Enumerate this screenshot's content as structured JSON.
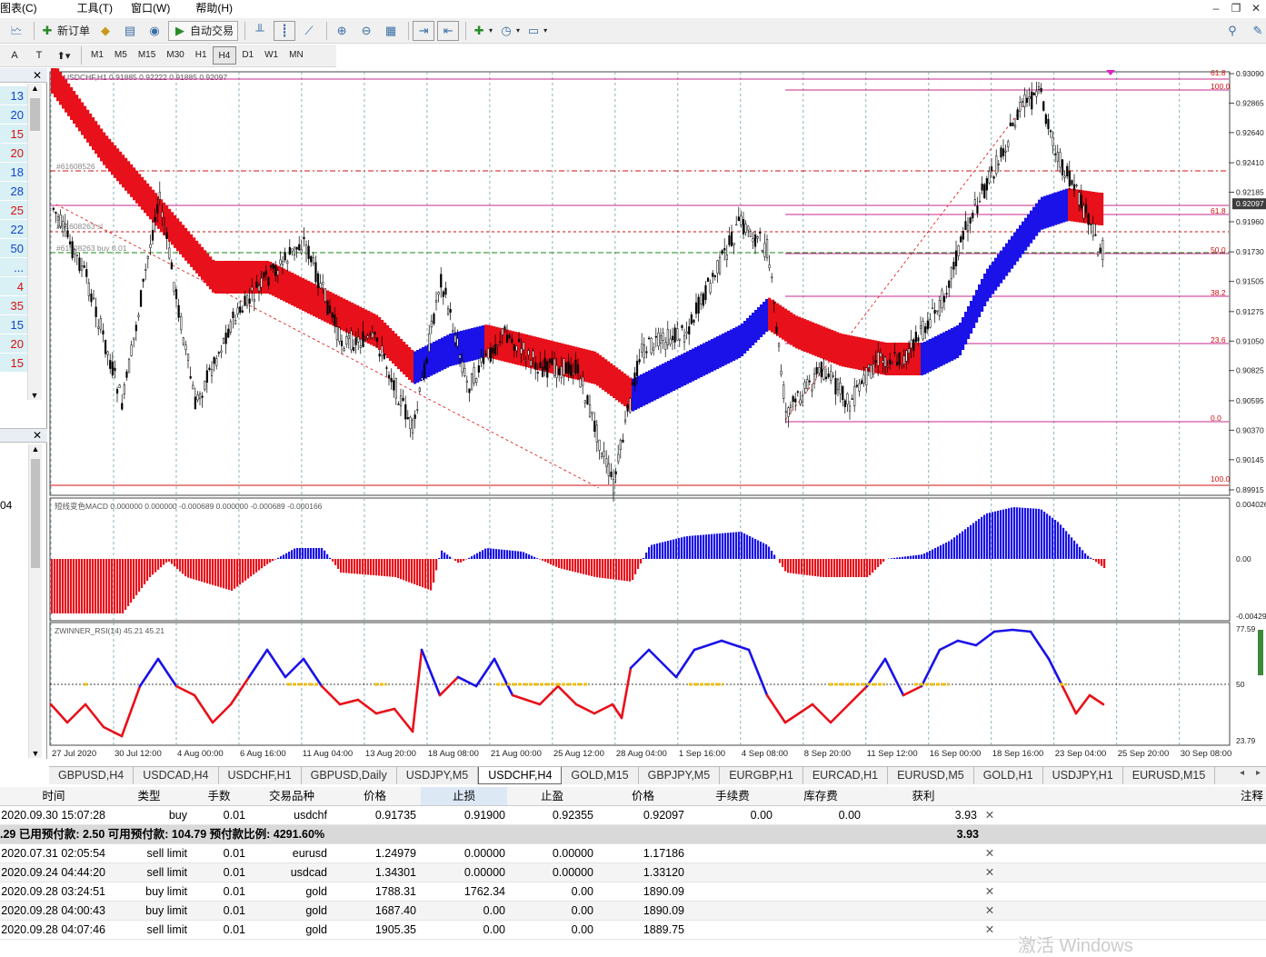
{
  "menu": [
    "图表(C)",
    "工具(T)",
    "窗口(W)",
    "帮助(H)"
  ],
  "toolbar": {
    "new_order": "新订单",
    "auto_trade": "自动交易"
  },
  "timeframes": [
    "M1",
    "M5",
    "M15",
    "M30",
    "H1",
    "H4",
    "D1",
    "W1",
    "MN"
  ],
  "active_timeframe": "H4",
  "left_panel": {
    "values": [
      "13",
      "20",
      "15",
      "20",
      "18",
      "28",
      "25",
      "22",
      "50",
      "...",
      "4",
      "35",
      "15",
      "20",
      "15"
    ],
    "partial_label": "04"
  },
  "chart": {
    "title": "USDCHF,H1  0.91885 0.92222 0.91885 0.92097",
    "order_labels": [
      "#61608526",
      "#61608263 sl",
      "#61608263 buy 0.01"
    ],
    "fib_labels": [
      "61.8",
      "100.0",
      "61.8",
      "50.0",
      "38.2",
      "23.6",
      "0.0",
      "100.0"
    ],
    "price_ticks": [
      "0.93090",
      "0.92865",
      "0.92640",
      "0.92410",
      "0.92185",
      "0.91960",
      "0.91730",
      "0.91505",
      "0.91275",
      "0.91050",
      "0.90825",
      "0.90595",
      "0.90370",
      "0.90145",
      "0.89915"
    ],
    "current_price": "0.92097",
    "macd_title": "短线变色MACD 0.000000 0.000000 -0.000689 0.000000 -0.000689 -0.000166",
    "macd_ticks": [
      "0.004026",
      "0.00",
      "-0.00429"
    ],
    "rsi_title": "ZWINNER_RSI(14) 45.21 45.21",
    "rsi_ticks": [
      "77.59",
      "50",
      "23.79"
    ],
    "time_labels": [
      "27 Jul 2020",
      "30 Jul 12:00",
      "4 Aug 00:00",
      "6 Aug 16:00",
      "11 Aug 04:00",
      "13 Aug 20:00",
      "18 Aug 08:00",
      "21 Aug 00:00",
      "25 Aug 12:00",
      "28 Aug 04:00",
      "1 Sep 16:00",
      "4 Sep 08:00",
      "8 Sep 20:00",
      "11 Sep 12:00",
      "16 Sep 00:00",
      "18 Sep 16:00",
      "23 Sep 04:00",
      "25 Sep 20:00",
      "30 Sep 08:00"
    ],
    "colors": {
      "up": "#1a12e8",
      "down": "#e8101a",
      "grid": "#6fa0a8"
    }
  },
  "tabs": [
    "GBPUSD,H4",
    "USDCAD,H4",
    "USDCHF,H1",
    "GBPUSD,Daily",
    "USDJPY,M5",
    "USDCHF,H4",
    "GOLD,M15",
    "GBPJPY,M5",
    "EURGBP,H1",
    "EURCAD,H1",
    "EURUSD,M5",
    "GOLD,H1",
    "USDJPY,H1",
    "EURUSD,M15"
  ],
  "active_tab": "USDCHF,H4",
  "terminal": {
    "headers": [
      "时间",
      "类型",
      "手数",
      "交易品种",
      "价格",
      "止损",
      "止盈",
      "价格",
      "手续费",
      "库存费",
      "获利",
      "注释"
    ],
    "open_row": [
      "2020.09.30 15:07:28",
      "buy",
      "0.01",
      "usdchf",
      "0.91735",
      "0.91900",
      "0.92355",
      "0.92097",
      "0.00",
      "0.00",
      "3.93"
    ],
    "summary": {
      "text": ".29  已用预付款: 2.50  可用预付款: 104.79  预付款比例: 4291.60%",
      "profit": "3.93"
    },
    "pending": [
      [
        "2020.07.31 02:05:54",
        "sell limit",
        "0.01",
        "eurusd",
        "1.24979",
        "0.00000",
        "0.00000",
        "1.17186"
      ],
      [
        "2020.09.24 04:44:20",
        "sell limit",
        "0.01",
        "usdcad",
        "1.34301",
        "0.00000",
        "0.00000",
        "1.33120"
      ],
      [
        "2020.09.28 03:24:51",
        "buy limit",
        "0.01",
        "gold",
        "1788.31",
        "1762.34",
        "0.00",
        "1890.09"
      ],
      [
        "2020.09.28 04:00:43",
        "buy limit",
        "0.01",
        "gold",
        "1687.40",
        "0.00",
        "0.00",
        "1890.09"
      ],
      [
        "2020.09.28 04:07:46",
        "sell limit",
        "0.01",
        "gold",
        "1905.35",
        "0.00",
        "0.00",
        "1889.75"
      ]
    ]
  },
  "watermark": "激活 Windows"
}
